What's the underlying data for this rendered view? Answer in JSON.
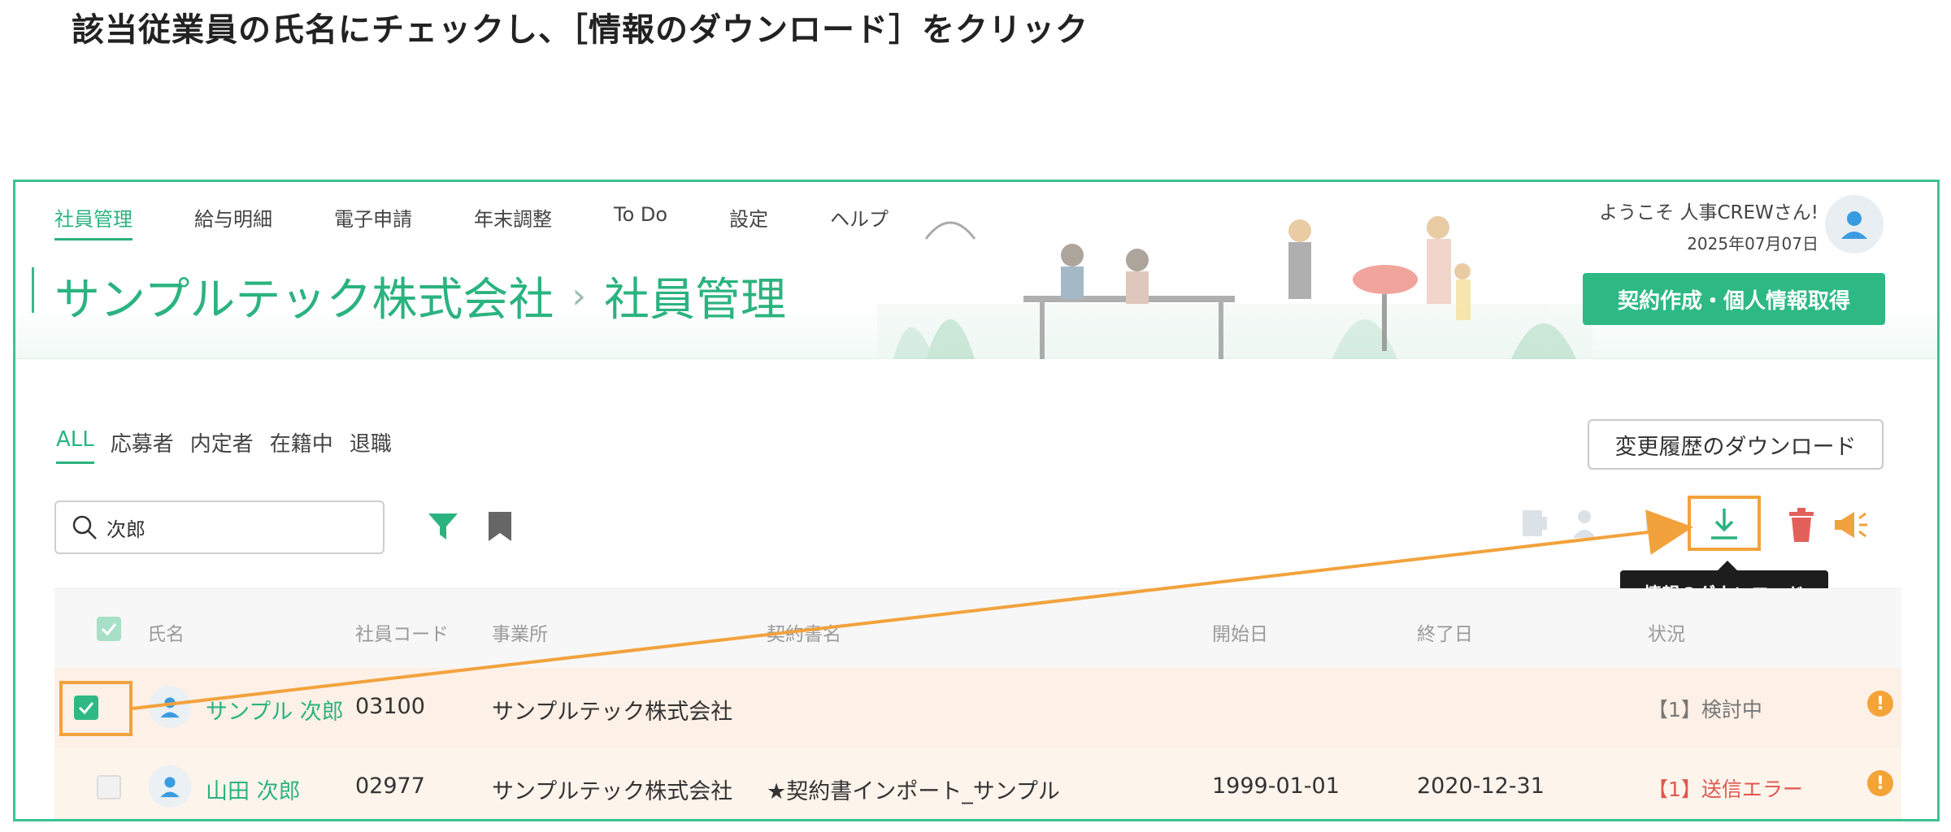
{
  "instruction": "該当従業員の氏名にチェックし、［情報のダウンロード］をクリック",
  "nav": {
    "items": [
      {
        "label": "社員管理",
        "active": true
      },
      {
        "label": "給与明細"
      },
      {
        "label": "電子申請"
      },
      {
        "label": "年末調整"
      },
      {
        "label": "To Do"
      },
      {
        "label": "設定"
      },
      {
        "label": "ヘルプ"
      }
    ]
  },
  "header": {
    "company": "サンプルテック株式会社",
    "separator": "›",
    "page": "社員管理",
    "welcome": "ようこそ 人事CREWさん!",
    "date": "2025年07月07日",
    "contract_button": "契約作成・個人情報取得"
  },
  "tabs": [
    {
      "label": "ALL",
      "active": true
    },
    {
      "label": "応募者"
    },
    {
      "label": "内定者"
    },
    {
      "label": "在籍中"
    },
    {
      "label": "退職"
    }
  ],
  "history_button": "変更履歴のダウンロード",
  "search": {
    "value": "次郎"
  },
  "tooltip": "情報のダウンロード",
  "table": {
    "headers": [
      "氏名",
      "社員コード",
      "事業所",
      "契約書名",
      "開始日",
      "終了日",
      "状況"
    ],
    "rows": [
      {
        "name": "サンプル 次郎",
        "code": "03100",
        "office": "サンプルテック株式会社",
        "contract": "",
        "start": "",
        "end": "",
        "status": "【1】検討中",
        "status_type": "ok",
        "checked": true
      },
      {
        "name": "山田 次郎",
        "code": "02977",
        "office": "サンプルテック株式会社",
        "contract": "★契約書インポート_サンプル",
        "start": "1999-01-01",
        "end": "2020-12-31",
        "status": "【1】送信エラー",
        "status_type": "error",
        "checked": false
      }
    ]
  },
  "colors": {
    "accent": "#2bb37f",
    "highlight": "#f2a23c",
    "error": "#e0574f"
  },
  "icons": [
    "search-icon",
    "filter-icon",
    "bookmark-icon",
    "download-icon",
    "trash-icon",
    "megaphone-icon",
    "alert-icon",
    "user-icon"
  ]
}
